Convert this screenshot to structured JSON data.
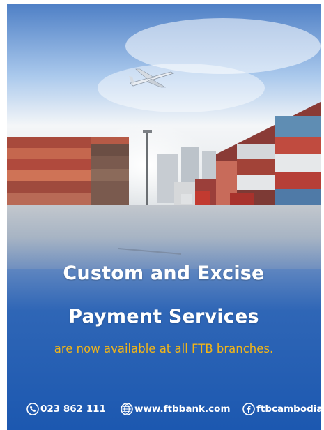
{
  "poster": {
    "headline_line1": "Custom and Excise",
    "headline_line2": "Payment Services",
    "subline": "are now available at all FTB branches."
  },
  "footer": {
    "phone": "023 862 111",
    "website": "www.ftbbank.com",
    "facebook": "ftbcambodia",
    "phone_icon": "phone-icon",
    "web_icon": "globe-icon",
    "facebook_icon": "facebook-icon"
  },
  "colors": {
    "headline": "#ffffff",
    "subline": "#f2b518",
    "background_blue": "#1c58b0"
  }
}
